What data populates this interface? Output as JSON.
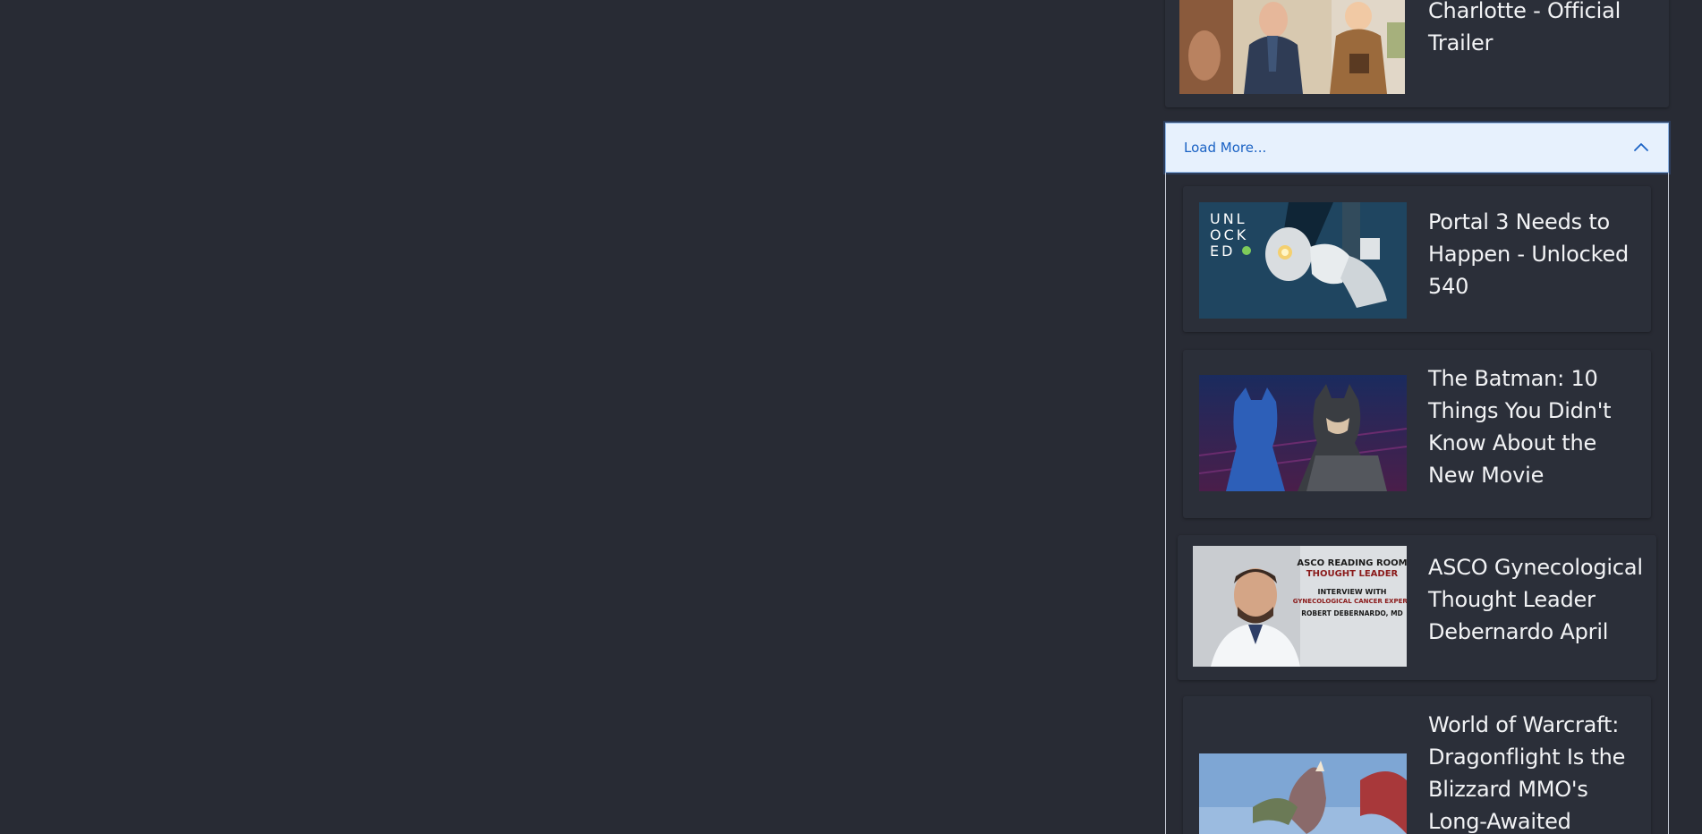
{
  "top_card": {
    "title": "Charlotte - Official Trailer",
    "thumbnail": "animated-trailer-thumbnail"
  },
  "load_more": {
    "label": "Load More...",
    "icon": "chevron-up-icon",
    "expanded": true
  },
  "videos": [
    {
      "title": "Portal 3 Needs to Happen - Unlocked 540",
      "thumbnail": "unlocked-portal-thumbnail",
      "thumbnail_text": [
        "UNL",
        "OCK",
        "ED"
      ]
    },
    {
      "title": "The Batman: 10 Things You Didn't Know About the New Movie",
      "thumbnail": "batman-thumbnail"
    },
    {
      "title": "ASCO Gynecological Thought Leader Debernardo April",
      "thumbnail": "asco-interview-thumbnail",
      "thumbnail_text": [
        "ASCO READING ROOM",
        "THOUGHT LEADER",
        "INTERVIEW WITH",
        "GYNECOLOGICAL CANCER EXPERT",
        "ROBERT DEBERNARDO, MD"
      ]
    },
    {
      "title": "World of Warcraft: Dragonflight Is the Blizzard MMO's Long-Awaited",
      "thumbnail": "dragonflight-thumbnail"
    }
  ],
  "colors": {
    "background": "#282b34",
    "card": "#2b2f39",
    "accent": "#1a62c4",
    "load_more_bg": "#e7f1fd"
  }
}
